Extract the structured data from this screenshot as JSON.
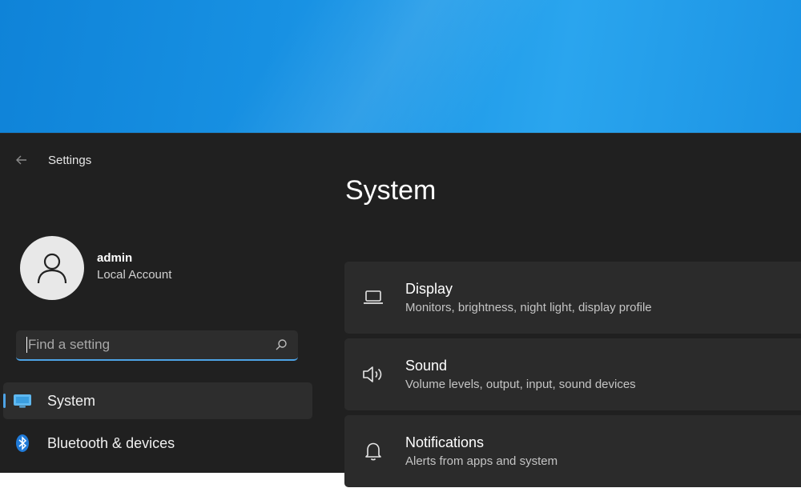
{
  "window": {
    "app_title": "Settings",
    "page_title": "System"
  },
  "profile": {
    "name": "admin",
    "account_type": "Local Account"
  },
  "search": {
    "placeholder": "Find a setting",
    "value": ""
  },
  "nav": {
    "items": [
      {
        "label": "System",
        "icon": "monitor-icon",
        "active": true
      },
      {
        "label": "Bluetooth & devices",
        "icon": "bluetooth-icon",
        "active": false
      }
    ]
  },
  "cards": [
    {
      "title": "Display",
      "description": "Monitors, brightness, night light, display profile",
      "icon": "laptop-icon"
    },
    {
      "title": "Sound",
      "description": "Volume levels, output, input, sound devices",
      "icon": "speaker-icon"
    },
    {
      "title": "Notifications",
      "description": "Alerts from apps and system",
      "icon": "bell-icon"
    }
  ],
  "colors": {
    "accent": "#4da3e6",
    "window_bg": "#202020",
    "card_bg": "#2b2b2b",
    "desktop": "#1a95e6"
  }
}
